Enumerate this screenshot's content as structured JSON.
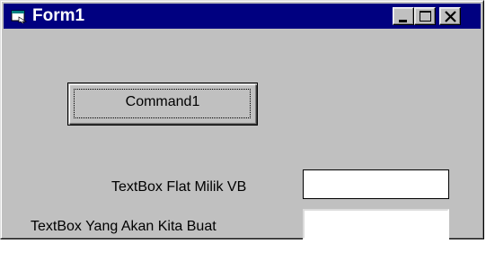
{
  "window": {
    "title": "Form1",
    "title_icon": "form-icon",
    "controls": {
      "minimize_icon": "minimize-icon",
      "maximize_icon": "maximize-icon",
      "close_icon": "close-icon"
    },
    "titlebar_color": "#000080",
    "face_color": "#c0c0c0"
  },
  "form": {
    "command_button_label": "Command1",
    "flat_textbox_label": "TextBox Flat Milik VB",
    "flat_textbox_value": "",
    "custom_textbox_label": "TextBox Yang Akan Kita Buat",
    "custom_textbox_value": ""
  }
}
